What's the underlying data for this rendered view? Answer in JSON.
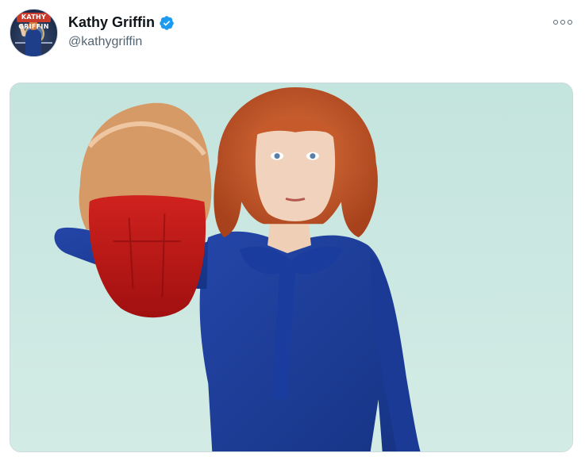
{
  "author": {
    "display_name": "Kathy Griffin",
    "handle": "@kathygriffin",
    "verified": true,
    "avatar_banner_text": "KATHY GRIFFIN"
  },
  "icons": {
    "verified": "verified-badge-icon",
    "more": "more-options-icon"
  },
  "colors": {
    "verified_blue": "#1d9bf0",
    "text_primary": "#0f1419",
    "text_secondary": "#536471",
    "media_background": "#c9e7e1",
    "dress_blue": "#1f3d9a",
    "hair_red": "#c75a2a"
  },
  "media": {
    "type": "photo"
  }
}
